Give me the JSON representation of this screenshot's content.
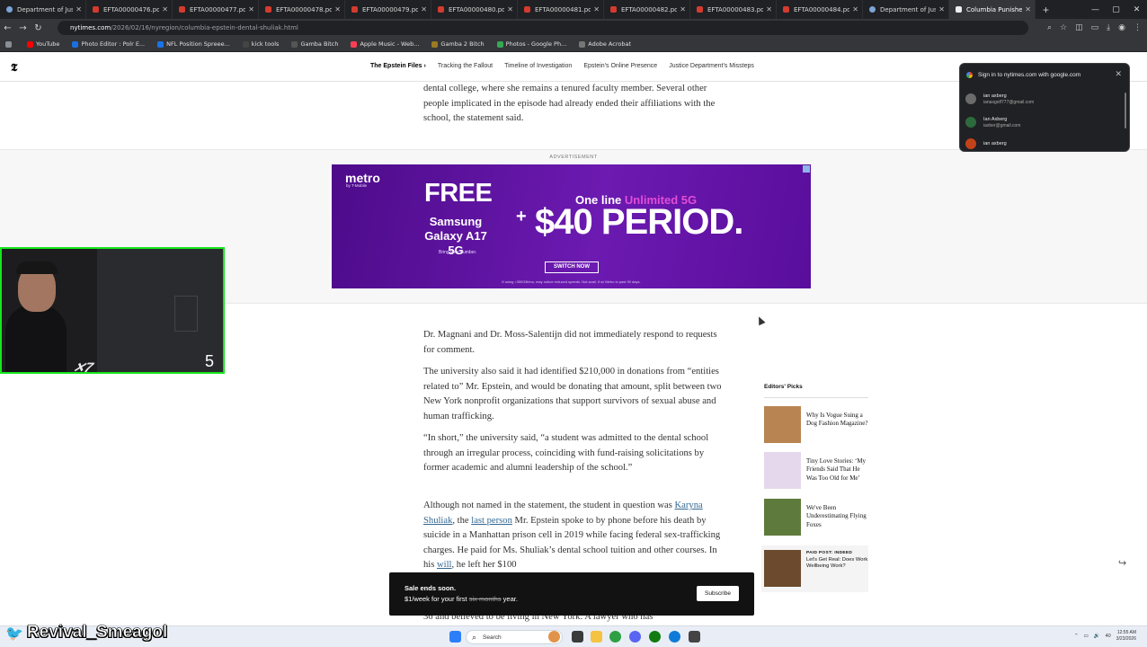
{
  "browser": {
    "tabs": [
      {
        "label": "Department of Justice",
        "type": "doj"
      },
      {
        "label": "EFTA00000476.pdf",
        "type": "pdf"
      },
      {
        "label": "EFTA00000477.pdf",
        "type": "pdf"
      },
      {
        "label": "EFTA00000478.pdf",
        "type": "pdf"
      },
      {
        "label": "EFTA00000479.pdf",
        "type": "pdf"
      },
      {
        "label": "EFTA00000480.pdf",
        "type": "pdf"
      },
      {
        "label": "EFTA00000481.pdf",
        "type": "pdf"
      },
      {
        "label": "EFTA00000482.pdf",
        "type": "pdf"
      },
      {
        "label": "EFTA00000483.pdf",
        "type": "pdf"
      },
      {
        "label": "EFTA00000484.pdf",
        "type": "pdf"
      },
      {
        "label": "Department of Justice",
        "type": "doj"
      },
      {
        "label": "Columbia Punishes 2",
        "type": "nyt",
        "active": true
      }
    ],
    "url_domain": "nytimes.com",
    "url_path": "/2026/02/16/nyregion/columbia-epstein-dental-shuliak.html",
    "bookmarks": [
      {
        "label": "",
        "color": "#8a8f96"
      },
      {
        "label": "YouTube",
        "color": "#ff0000"
      },
      {
        "label": "Photo Editor : Polr E...",
        "color": "#1b6fe0"
      },
      {
        "label": "NFL Position Spreee...",
        "color": "#1a73e8"
      },
      {
        "label": "kick tools",
        "color": "#444"
      },
      {
        "label": "Gamba Bitch",
        "color": "#555"
      },
      {
        "label": "Apple Music - Web...",
        "color": "#fa3f55"
      },
      {
        "label": "Gamba 2 Bitch",
        "color": "#9b7b22"
      },
      {
        "label": "Photos - Google Ph...",
        "color": "#34a853"
      },
      {
        "label": "Adobe Acrobat",
        "color": "#777"
      }
    ]
  },
  "nyt": {
    "logo": "𝕿",
    "subnav": [
      "The Epstein Files ›",
      "Tracking the Fallout",
      "Timeline of Investigation",
      "Epstein's Online Presence",
      "Justice Department's Missteps"
    ]
  },
  "article": {
    "p0": "dental college, where she remains a tenured faculty member. Several other people implicated in the episode had already ended their affiliations with the school, the statement said.",
    "p1": "Dr. Magnani and Dr. Moss-Salentijn did not immediately respond to requests for comment.",
    "p2": "The university also said it had identified $210,000 in donations from “entities related to” Mr. Epstein, and would be donating that amount, split between two New York nonprofit organizations that support survivors of sexual abuse and human trafficking.",
    "p3": "“In short,” the university said, “a student was admitted to the dental school through an irregular process, coinciding with fund-raising solicitations by former academic and alumni leadership of the school.”",
    "p4_a": "Although not named in the statement, the student in question was ",
    "p4_link1": "Karyna Shuliak",
    "p4_b": ", the ",
    "p4_link2": "last person",
    "p4_c": " Mr. Epstein spoke to by phone before his death by suicide in a Manhattan prison cell in 2019 while facing federal sex-trafficking charges. He paid for Ms. Shuliak’s dental school tuition and other courses. In his ",
    "p4_link3": "will",
    "p4_d": ", he left her $100",
    "p5": "36 and believed to be living in New York. A lawyer who has"
  },
  "ad": {
    "label": "ADVERTISEMENT",
    "brand": "metro",
    "brand_sub": "by T-Mobile",
    "free": "FREE",
    "phone": "Samsung Galaxy A17 5G",
    "bring": "Bring your number.",
    "plus": "+",
    "one_line_a": "One line ",
    "one_line_b": "Unlimited 5G",
    "price": "$40 PERIOD.",
    "cta": "SWITCH NOW",
    "fine": "If using >350GB/mo, may notice reduced speeds. Not avail. if w/ Metro in past 90 days."
  },
  "google_popup": {
    "title": "Sign in to nytimes.com with google.com",
    "accounts": [
      {
        "name": "ian axberg",
        "email": "ianaxgolf777@gmail.com",
        "color": "#6b6b6b"
      },
      {
        "name": "Ian Axberg",
        "email": "iaxber@gmail.com",
        "color": "#2d6a3e"
      },
      {
        "name": "ian axberg",
        "email": "",
        "color": "#c4421a"
      }
    ]
  },
  "stream": {
    "cam_number": "5",
    "cam_logo": "✕7",
    "username": "Revival_Smeagol",
    "bird": "🐦"
  },
  "editors_picks": {
    "title": "Editors' Picks",
    "items": [
      {
        "text": "Why Is Vogue Suing a Dog Fashion Magazine?",
        "color": "#b88451"
      },
      {
        "text": "Tiny Love Stories: ‘My Friends Said That He Was Too Old for Me’",
        "color": "#e6d8ec"
      },
      {
        "text": "We've Been Underestimating Flying Foxes",
        "color": "#5e7a3c"
      }
    ],
    "promo_tag": "PAID POST: INDEED",
    "promo_text": "Let's Get Real: Does Work Wellbeing Work?",
    "promo_color": "#6b4a2e"
  },
  "sale": {
    "line1": "Sale ends soon.",
    "line2_a": "$1/week for your first ",
    "line2_strike": "six months",
    "line2_b": " year.",
    "button": "Subscribe"
  },
  "taskbar": {
    "search": "Search",
    "time": "12:55 AM",
    "date": "3/23/2026",
    "volume": "40"
  }
}
